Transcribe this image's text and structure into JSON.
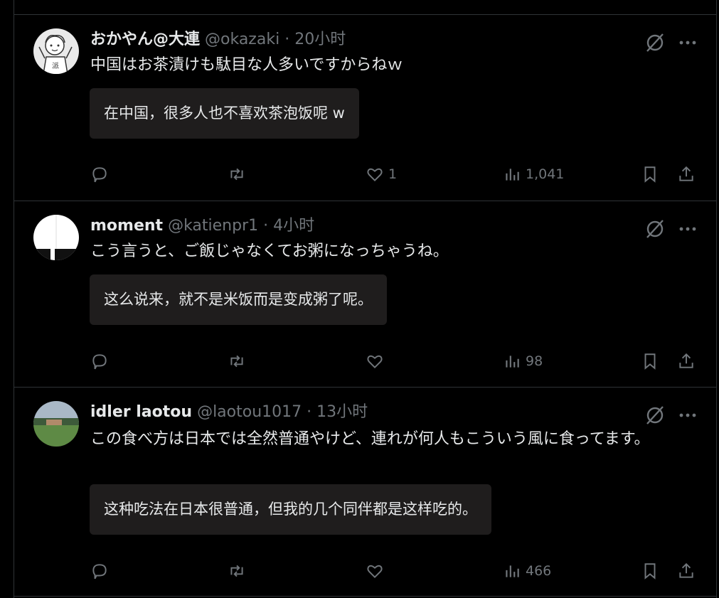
{
  "colors": {
    "background": "#000000",
    "text": "#e7e9ea",
    "muted": "#71767b",
    "translation_bg": "#1f1d1d",
    "border": "#2f3336"
  },
  "tweets": [
    {
      "name": "おかやん@大連",
      "handle": "@okazaki",
      "dot": "·",
      "time": "20小时",
      "text": "中国はお茶漬けも駄目な人多いですからねｗ",
      "translation": "在中国，很多人也不喜欢茶泡饭呢 w",
      "likes": "1",
      "views": "1,041",
      "avatar_icon": "cartoon-avatar"
    },
    {
      "name": "moment",
      "handle": "@katienpr1",
      "dot": "·",
      "time": "4小时",
      "text": "こう言うと、ご飯じゃなくてお粥になっちゃうね。",
      "translation": "这么说来，就不是米饭而是变成粥了呢。",
      "likes": "",
      "views": "98",
      "avatar_icon": "white-shape-avatar"
    },
    {
      "name": "idler laotou",
      "handle": "@laotou1017",
      "dot": "·",
      "time": "13小时",
      "text": "この食べ方は日本では全然普通やけど、連れが何人もこういう風に食ってます。",
      "translation": "这种吃法在日本很普通，但我的几个同伴都是这样吃的。",
      "likes": "",
      "views": "466",
      "avatar_icon": "landscape-avatar"
    }
  ]
}
